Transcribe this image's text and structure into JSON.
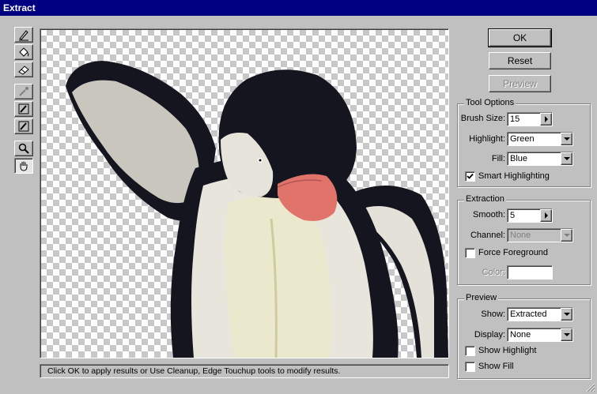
{
  "window": {
    "title": "Extract"
  },
  "buttons": {
    "ok": "OK",
    "reset": "Reset",
    "preview": "Preview"
  },
  "tool_options": {
    "legend": "Tool Options",
    "brush_size_label": "Brush Size:",
    "brush_size_value": "15",
    "highlight_label": "Highlight:",
    "highlight_value": "Green",
    "fill_label": "Fill:",
    "fill_value": "Blue",
    "smart_highlighting_label": "Smart Highlighting",
    "smart_highlighting_checked": true
  },
  "extraction": {
    "legend": "Extraction",
    "smooth_label": "Smooth:",
    "smooth_value": "5",
    "channel_label": "Channel:",
    "channel_value": "None",
    "force_foreground_label": "Force Foreground",
    "force_foreground_checked": false,
    "color_label": "Color:"
  },
  "preview": {
    "legend": "Preview",
    "show_label": "Show:",
    "show_value": "Extracted",
    "display_label": "Display:",
    "display_value": "None",
    "show_highlight_label": "Show Highlight",
    "show_highlight_checked": false,
    "show_fill_label": "Show Fill",
    "show_fill_checked": false
  },
  "status": {
    "message": "Click OK to apply results or Use Cleanup, Edge Touchup tools to modify results."
  },
  "toolbox": [
    {
      "name": "edge-highlighter-icon"
    },
    {
      "name": "fill-bucket-icon"
    },
    {
      "name": "eraser-icon"
    },
    {
      "name": "eyedropper-icon"
    },
    {
      "name": "cleanup-tool-icon"
    },
    {
      "name": "edge-touchup-icon"
    },
    {
      "name": "zoom-icon"
    },
    {
      "name": "hand-icon"
    }
  ],
  "colors": {
    "title_bar": "#000080",
    "dialog_bg": "#c0c0c0",
    "penguin_black": "#15151f",
    "penguin_white": "#e8e6dc",
    "beak": "#e0736a"
  }
}
